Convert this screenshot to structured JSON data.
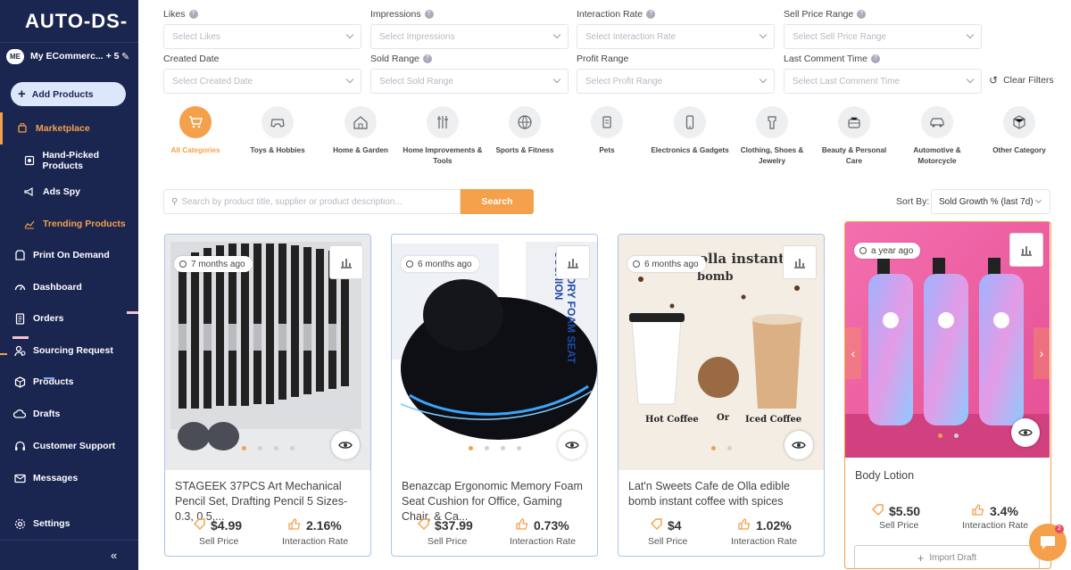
{
  "app": {
    "logo": "AUTO-DS-"
  },
  "sidebar": {
    "store_initials": "ME",
    "store_name": "My ECommerc... + 5",
    "add_products": "Add Products",
    "items": [
      {
        "label": "Marketplace",
        "icon": "cart-icon"
      },
      {
        "label": "Hand-Picked Products",
        "icon": "hand-picked-icon"
      },
      {
        "label": "Ads Spy",
        "icon": "megaphone-icon"
      },
      {
        "label": "Trending Products",
        "icon": "trend-icon"
      },
      {
        "label": "Print On Demand",
        "icon": "print-icon"
      },
      {
        "label": "Dashboard",
        "icon": "gauge-icon"
      },
      {
        "label": "Orders",
        "icon": "orders-icon"
      },
      {
        "label": "Sourcing Request",
        "icon": "sourcing-icon"
      },
      {
        "label": "Products",
        "icon": "box-icon"
      },
      {
        "label": "Drafts",
        "icon": "drafts-icon"
      },
      {
        "label": "Customer Support",
        "icon": "support-icon"
      },
      {
        "label": "Messages",
        "icon": "mail-icon"
      },
      {
        "label": "Settings",
        "icon": "gear-icon"
      }
    ],
    "collapse": "«"
  },
  "filters": [
    {
      "label": "Likes",
      "placeholder": "Select Likes",
      "help": true
    },
    {
      "label": "Impressions",
      "placeholder": "Select Impressions",
      "help": true
    },
    {
      "label": "Interaction Rate",
      "placeholder": "Select Interaction Rate",
      "help": true
    },
    {
      "label": "Sell Price Range",
      "placeholder": "Select Sell Price Range",
      "help": true
    },
    {
      "label": "Created Date",
      "placeholder": "Select Created Date",
      "help": false
    },
    {
      "label": "Sold Range",
      "placeholder": "Select Sold Range",
      "help": true
    },
    {
      "label": "Profit Range",
      "placeholder": "Select Profit Range",
      "help": false
    },
    {
      "label": "Last Comment Time",
      "placeholder": "Select Last Comment Time",
      "help": true
    }
  ],
  "clear_filters": "Clear Filters",
  "categories": [
    {
      "label": "All Categories",
      "icon": "cart-icon",
      "active": true
    },
    {
      "label": "Toys & Hobbies",
      "icon": "gamepad-icon"
    },
    {
      "label": "Home & Garden",
      "icon": "house-icon"
    },
    {
      "label": "Home Improvements & Tools",
      "icon": "tools-icon"
    },
    {
      "label": "Sports & Fitness",
      "icon": "ball-icon"
    },
    {
      "label": "Pets",
      "icon": "pet-food-icon"
    },
    {
      "label": "Electronics & Gadgets",
      "icon": "phone-icon"
    },
    {
      "label": "Clothing, Shoes & Jewelry",
      "icon": "dress-icon"
    },
    {
      "label": "Beauty & Personal Care",
      "icon": "beauty-icon"
    },
    {
      "label": "Automotive & Motorcycle",
      "icon": "car-icon"
    },
    {
      "label": "Other Category",
      "icon": "cube-icon"
    }
  ],
  "search": {
    "placeholder": "Search by product title, supplier or product description...",
    "button": "Search"
  },
  "sort": {
    "label": "Sort By:",
    "value": "Sold Growth % (last 7d)"
  },
  "products": [
    {
      "age": "7 months ago",
      "title": "STAGEEK 37PCS Art Mechanical Pencil Set, Drafting Pencil 5 Sizes- 0.3, 0.5,...",
      "price": "$4.99",
      "price_label": "Sell Price",
      "rate": "2.16%",
      "rate_label": "Interaction Rate"
    },
    {
      "age": "6 months ago",
      "title": "Benazcap Ergonomic Memory Foam Seat Cushion for Office, Gaming Chair, & Ca...",
      "price": "$37.99",
      "price_label": "Sell Price",
      "rate": "0.73%",
      "rate_label": "Interaction Rate",
      "image_text": "MEMORY FOAM SEAT CUSHION"
    },
    {
      "age": "6 months ago",
      "title": "Lat'n Sweets Cafe de Olla edible bomb instant coffee with spices",
      "price": "$4",
      "price_label": "Sell Price",
      "rate": "1.02%",
      "rate_label": "Interaction Rate",
      "image_text": {
        "top": "olla instant",
        "mid": "bomb",
        "left": "Hot Coffee",
        "or": "Or",
        "right": "Iced Coffee"
      }
    },
    {
      "age": "a year ago",
      "title": "Body Lotion",
      "price": "$5.50",
      "price_label": "Sell Price",
      "rate": "3.4%",
      "rate_label": "Interaction Rate",
      "import": "Import Draft"
    }
  ],
  "chat_badge": "2",
  "colors": {
    "accent": "#f5a04a",
    "sidebar": "#1a2550",
    "card_border": "#a9c4ee"
  }
}
